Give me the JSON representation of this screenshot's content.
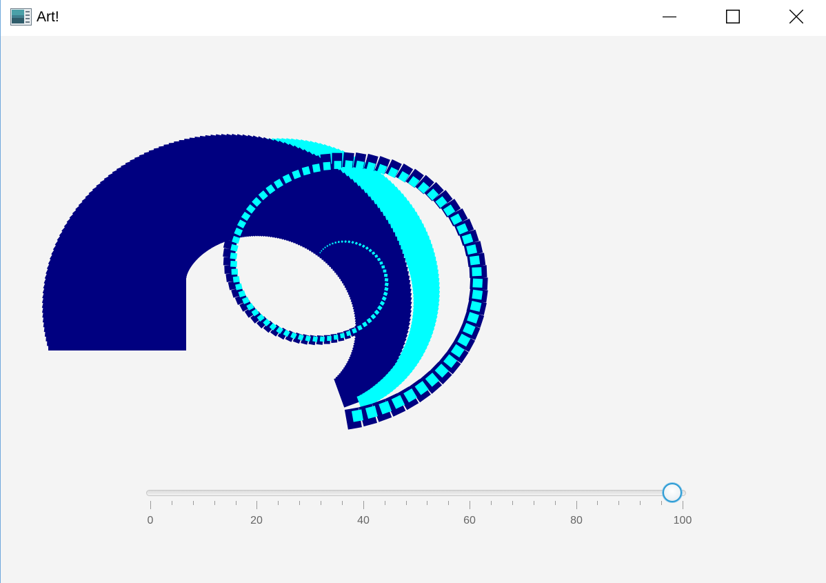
{
  "window": {
    "title": "Art!",
    "controls": {
      "minimize": "minimize",
      "maximize": "maximize",
      "close": "close"
    }
  },
  "art": {
    "colors": {
      "dark": "#000080",
      "light": "#00ffff"
    }
  },
  "slider": {
    "min": 0,
    "max": 100,
    "value": 98,
    "major_ticks": [
      "0",
      "20",
      "40",
      "60",
      "80",
      "100"
    ],
    "minor_tick_count": 4
  }
}
